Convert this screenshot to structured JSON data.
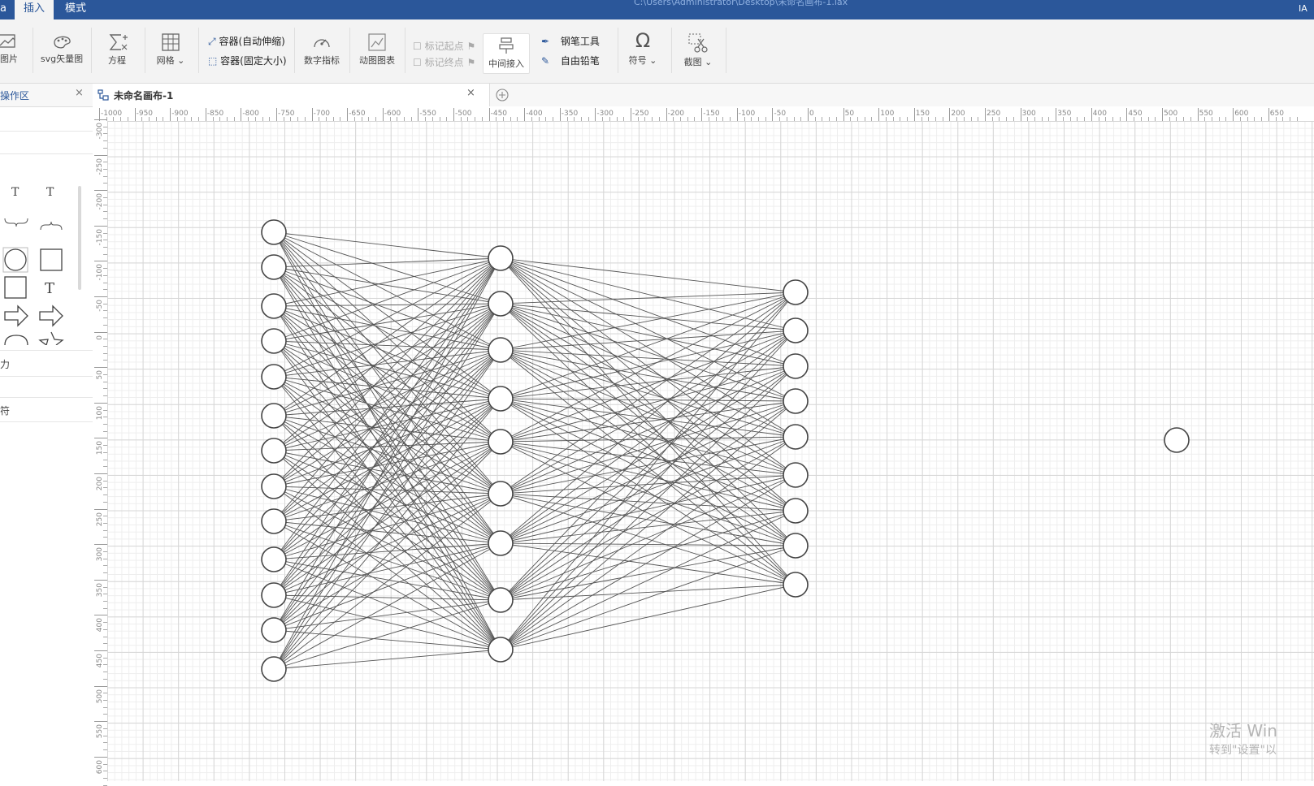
{
  "titlebar": {
    "tabs": [
      {
        "label": "插入",
        "active": true
      },
      {
        "label": "模式",
        "active": false
      }
    ],
    "left_fragment": "a",
    "file_path": "C:\\Users\\Administrator\\Desktop\\未命名画布-1.lax",
    "right_fragment": "IA"
  },
  "ribbon": {
    "image_label": "图片",
    "svg_label": "svg矢量图",
    "equation_label": "方程",
    "grid_label": "网格",
    "container_auto_label": "容器(自动伸缩)",
    "container_fixed_label": "容器(固定大小)",
    "digital_indicator_label": "数字指标",
    "animated_chart_label": "动图图表",
    "mark_start_label": "标记起点",
    "mark_end_label": "标记终点",
    "middle_insert_label": "中间接入",
    "pen_tool_label": "钢笔工具",
    "free_pencil_label": "自由铅笔",
    "symbol_label": "符号",
    "screenshot_label": "截图"
  },
  "left_panel": {
    "tab_label": "操作区",
    "row1_fragment": "力",
    "row2_fragment": "符"
  },
  "document_tab": {
    "title": "未命名画布-1"
  },
  "ruler": {
    "top_ticks": [
      "-1000",
      "-950",
      "-900",
      "-850",
      "-800",
      "-750",
      "-700",
      "-650",
      "-600",
      "-550",
      "-500",
      "-450",
      "-400",
      "-350",
      "-300",
      "-250",
      "-200",
      "-150",
      "-100",
      "-50",
      "0",
      "50",
      "100",
      "150",
      "200",
      "250",
      "300",
      "350",
      "400",
      "450",
      "500",
      "550",
      "600",
      "650"
    ],
    "left_ticks": [
      "-300",
      "-250",
      "-200",
      "-150",
      "-100",
      "-50",
      "0",
      "50",
      "100",
      "150",
      "200",
      "250",
      "300",
      "350",
      "400",
      "450",
      "500",
      "550",
      "600"
    ]
  },
  "diagram": {
    "layers": [
      {
        "name": "input-layer",
        "nodes": 13
      },
      {
        "name": "hidden-layer",
        "nodes": 9
      },
      {
        "name": "output-layer",
        "nodes": 9
      }
    ],
    "isolated_nodes": 1,
    "stroke_color": "#444444",
    "fill_color": "#ffffff"
  },
  "watermark": {
    "line1": "激活 Win",
    "line2": "转到\"设置\"以"
  },
  "colors": {
    "title_bar": "#2b579a",
    "accent": "#2b579a",
    "ribbon_bg": "#f3f3f3"
  }
}
